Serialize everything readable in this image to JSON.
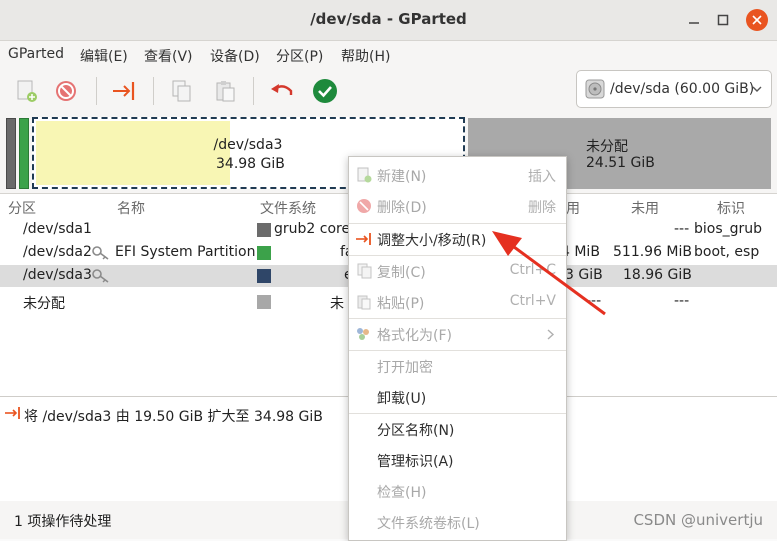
{
  "window": {
    "title": "/dev/sda - GParted"
  },
  "menubar": [
    "GParted",
    "编辑(E)",
    "查看(V)",
    "设备(D)",
    "分区(P)",
    "帮助(H)"
  ],
  "toolbar": {
    "icons": [
      "new-partition-icon",
      "delete-icon",
      "resize-move-icon",
      "copy-icon",
      "paste-icon",
      "undo-icon",
      "apply-icon"
    ]
  },
  "device": {
    "label": "/dev/sda  (60.00 GiB)"
  },
  "diskmap": {
    "sda3_name": "/dev/sda3",
    "sda3_size": "34.98 GiB",
    "unalloc_name": "未分配",
    "unalloc_size": "24.51 GiB"
  },
  "table": {
    "headers": [
      "分区",
      "名称",
      "文件系统",
      "用",
      "未用",
      "标识"
    ],
    "rows": [
      {
        "partition": "/dev/sda1",
        "name": "",
        "fs": "grub2 core.",
        "used": "",
        "unused": "---",
        "flags": "bios_grub",
        "color": "#6b6b6b"
      },
      {
        "partition": "/dev/sda2",
        "name": "EFI System Partition",
        "fs": "fa",
        "used": "4 MiB",
        "unused": "511.96 MiB",
        "flags": "boot, esp",
        "color": "#3ca24a"
      },
      {
        "partition": "/dev/sda3",
        "name": "",
        "fs": "e",
        "used": "3 GiB",
        "unused": "18.96 GiB",
        "flags": "",
        "color": "#2f4668"
      },
      {
        "partition": "未分配",
        "name": "",
        "fs": "未",
        "used": "---",
        "unused": "---",
        "flags": "",
        "color": "#a8a8a8"
      }
    ]
  },
  "operations": {
    "item": "将 /dev/sda3 由 19.50 GiB 扩大至 34.98 GiB"
  },
  "status": {
    "text": "1 项操作待处理"
  },
  "context_menu": {
    "items": [
      {
        "label": "新建(N)",
        "accel": "插入",
        "enabled": false
      },
      {
        "label": "删除(D)",
        "accel": "删除",
        "enabled": false
      },
      {
        "label": "调整大小/移动(R)",
        "accel": "",
        "enabled": true
      },
      {
        "label": "复制(C)",
        "accel": "Ctrl+C",
        "enabled": false
      },
      {
        "label": "粘贴(P)",
        "accel": "Ctrl+V",
        "enabled": false
      },
      {
        "label": "格式化为(F)",
        "accel": "",
        "enabled": false
      },
      {
        "label": "打开加密",
        "accel": "",
        "enabled": false
      },
      {
        "label": "卸载(U)",
        "accel": "",
        "enabled": true
      },
      {
        "label": "分区名称(N)",
        "accel": "",
        "enabled": true
      },
      {
        "label": "管理标识(A)",
        "accel": "",
        "enabled": true
      },
      {
        "label": "检查(H)",
        "accel": "",
        "enabled": false
      },
      {
        "label": "文件系统卷标(L)",
        "accel": "",
        "enabled": false
      }
    ]
  },
  "watermark": "CSDN @univertju"
}
